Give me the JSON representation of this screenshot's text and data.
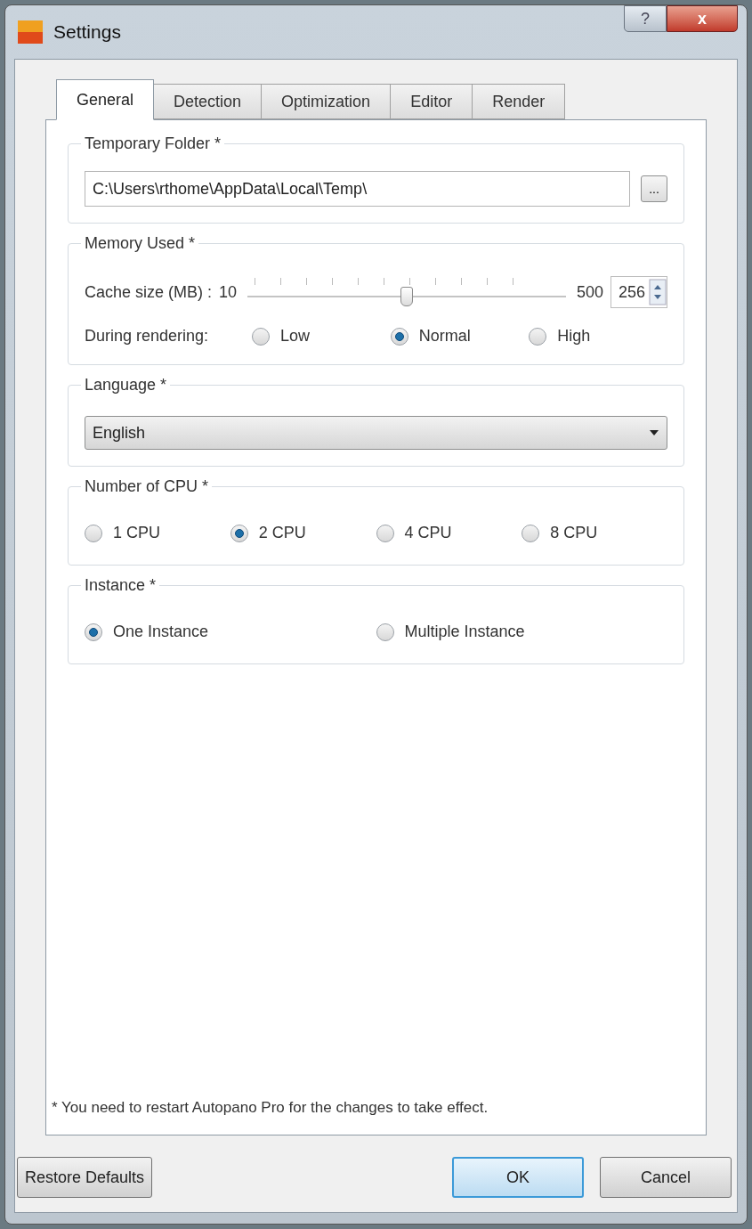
{
  "window": {
    "title": "Settings",
    "help_button": "?",
    "close_button": "x"
  },
  "tabs": [
    {
      "label": "General",
      "selected": true
    },
    {
      "label": "Detection",
      "selected": false
    },
    {
      "label": "Optimization",
      "selected": false
    },
    {
      "label": "Editor",
      "selected": false
    },
    {
      "label": "Render",
      "selected": false
    }
  ],
  "groups": [
    {
      "kind": "path",
      "title": "Temporary Folder *",
      "value": "C:\\Users\\rthome\\AppData\\Local\\Temp\\",
      "browse_button": "..."
    },
    {
      "kind": "memory",
      "title": "Memory Used *",
      "cache_label": "Cache size (MB) :",
      "min": "10",
      "max": "500",
      "level": 0.5,
      "spin_value": "256",
      "rendering_label": "During rendering:",
      "options": [
        {
          "label": "Low",
          "selected": false
        },
        {
          "label": "Normal",
          "selected": true
        },
        {
          "label": "High",
          "selected": false
        }
      ]
    },
    {
      "kind": "dropdown",
      "title": "Language *",
      "value": "English"
    },
    {
      "kind": "radios",
      "title": "Number of CPU *",
      "options": [
        {
          "label": "1 CPU",
          "selected": false
        },
        {
          "label": "2 CPU",
          "selected": true
        },
        {
          "label": "4 CPU",
          "selected": false
        },
        {
          "label": "8 CPU",
          "selected": false
        }
      ]
    },
    {
      "kind": "radios",
      "title": "Instance *",
      "options": [
        {
          "label": "One Instance",
          "selected": true
        },
        {
          "label": "Multiple Instance",
          "selected": false
        }
      ]
    }
  ],
  "footnote": "* You need to restart Autopano Pro for the changes to take effect.",
  "buttons": {
    "restore": "Restore Defaults",
    "ok": "OK",
    "cancel": "Cancel"
  }
}
